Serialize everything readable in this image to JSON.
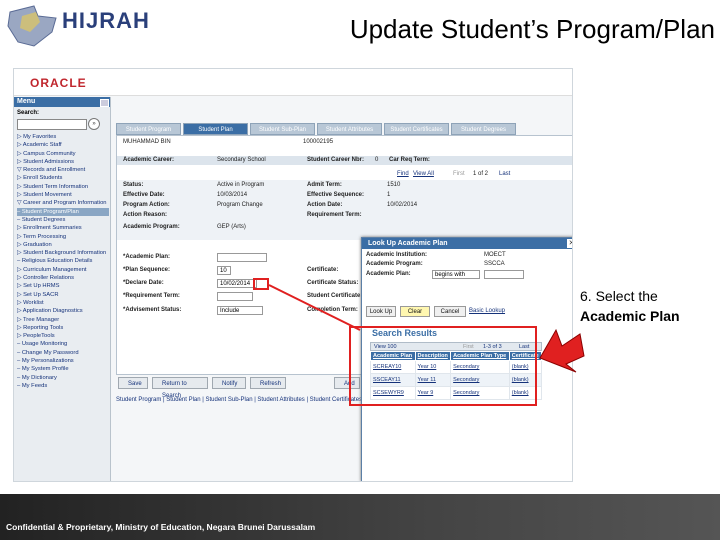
{
  "slide": {
    "title": "Update Student’s Program/Plan",
    "annotation_line1": "6. Select the",
    "annotation_line2": "Academic Plan",
    "footer": "Confidential & Proprietary, Ministry of Education, Negara Brunei Darussalam",
    "logo_text": "HIJRAH",
    "colors": {
      "accent_red": "#e02020",
      "ps_blue": "#3b6ea5",
      "oracle_red": "#c0262d"
    }
  },
  "app": {
    "brand": "ORACLE",
    "menu": {
      "title": "Menu",
      "search_label": "Search:",
      "search_button_icon": "go-icon",
      "items": [
        "▷ My Favorites",
        "▷ Academic Staff",
        "▷ Campus Community",
        "▷ Student Admissions",
        "▽ Records and Enrollment",
        "  ▷ Enroll Students",
        "  ▷ Student Term Information",
        "  ▷ Student Movement",
        "  ▽ Career and Program Information",
        "    – Student Program/Plan",
        "    – Student Degrees",
        "  ▷ Enrollment Summaries",
        "  ▷ Term Processing",
        "  ▷ Graduation",
        "  ▷ Student Background Information",
        "  – Religious Education Details",
        "▷ Curriculum Management",
        "▷ Controller Relations",
        "▷ Set Up HRMS",
        "▷ Set Up SACR",
        "▷ Worklist",
        "▷ Application Diagnostics",
        "▷ Tree Manager",
        "▷ Reporting Tools",
        "▷ PeopleTools",
        "– Usage Monitoring",
        "– Change My Password",
        "– My Personalizations",
        "– My System Profile",
        "– My Dictionary",
        "– My Feeds"
      ],
      "highlight_index": 9
    },
    "tabs": [
      "Student Program",
      "Student Plan",
      "Student Sub-Plan",
      "Student Attributes",
      "Student Certificates",
      "Student Degrees"
    ],
    "active_tab_index": 1,
    "header": {
      "student_name": "MUHAMMAD BIN",
      "student_id": "100002195"
    },
    "career": {
      "label": "Academic Career:",
      "value": "Secondary School",
      "career_nbr_label": "Student Career Nbr:",
      "career_nbr_value": "0",
      "car_req_label": "Car Req Term:"
    },
    "nav": {
      "find": "Find",
      "view_all": "View All",
      "first": "First",
      "count": "1 of 2",
      "last": "Last"
    },
    "status": {
      "status_label": "Status:",
      "status_value": "Active in Program",
      "admit_term_label": "Admit Term:",
      "admit_term_value": "1510",
      "effdate_label": "Effective Date:",
      "effdate_value": "10/03/2014",
      "effseq_label": "Effective Sequence:",
      "effseq_value": "1",
      "prog_action_label": "Program Action:",
      "prog_action_value": "Program Change",
      "action_date_label": "Action Date:",
      "action_date_value": "10/02/2014",
      "action_reason_label": "Action Reason:",
      "req_term_label": "Requirement Term:",
      "acad_program_label": "Academic Program:",
      "acad_program_value": "GEP (Arts)"
    },
    "plan": {
      "plan_label": "*Academic Plan:",
      "plan_value": "",
      "plan_seq_label": "*Plan Sequence:",
      "plan_seq_value": "10",
      "declare_label": "*Declare Date:",
      "declare_value": "10/02/2014",
      "req_term_label": "*Requirement Term:",
      "req_term_value": "",
      "advise_label": "*Advisement Status:",
      "advise_value": "Include",
      "certificate_label": "Certificate:",
      "cert_status_label": "Certificate Status:",
      "student_cert_label": "Student Certificate:",
      "completion_label": "Completion Term:"
    },
    "buttons": {
      "save": "Save",
      "return": "Return to Search",
      "notify": "Notify",
      "refresh": "Refresh",
      "add": "Add"
    },
    "links": "Student Program | Student Plan | Student Sub-Plan | Student Attributes | Student Certificates |",
    "lookup": {
      "title": "Look Up Academic Plan",
      "inst_label": "Academic Institution:",
      "inst_value": "MOECT",
      "program_label": "Academic Program:",
      "program_value": "SSCCA",
      "plan_label": "Academic Plan:",
      "operator": "begins with",
      "lookup_btn": "Look Up",
      "clear_btn": "Clear",
      "cancel_btn": "Cancel",
      "basic_link": "Basic Lookup",
      "results_title": "Search Results",
      "results_nav": {
        "view": "View 100",
        "first": "First",
        "count": "1-3 of 3",
        "last": "Last"
      },
      "columns": [
        "Academic Plan",
        "Description",
        "Academic Plan Type",
        "Certificate"
      ],
      "rows": [
        [
          "SCREAY10",
          "Year 10",
          "Secondary",
          "(blank)"
        ],
        [
          "SSCEAY11",
          "Year 11",
          "Secondary",
          "(blank)"
        ],
        [
          "SCSEWYR9",
          "Year 9",
          "Secondary",
          "(blank)"
        ]
      ]
    }
  }
}
